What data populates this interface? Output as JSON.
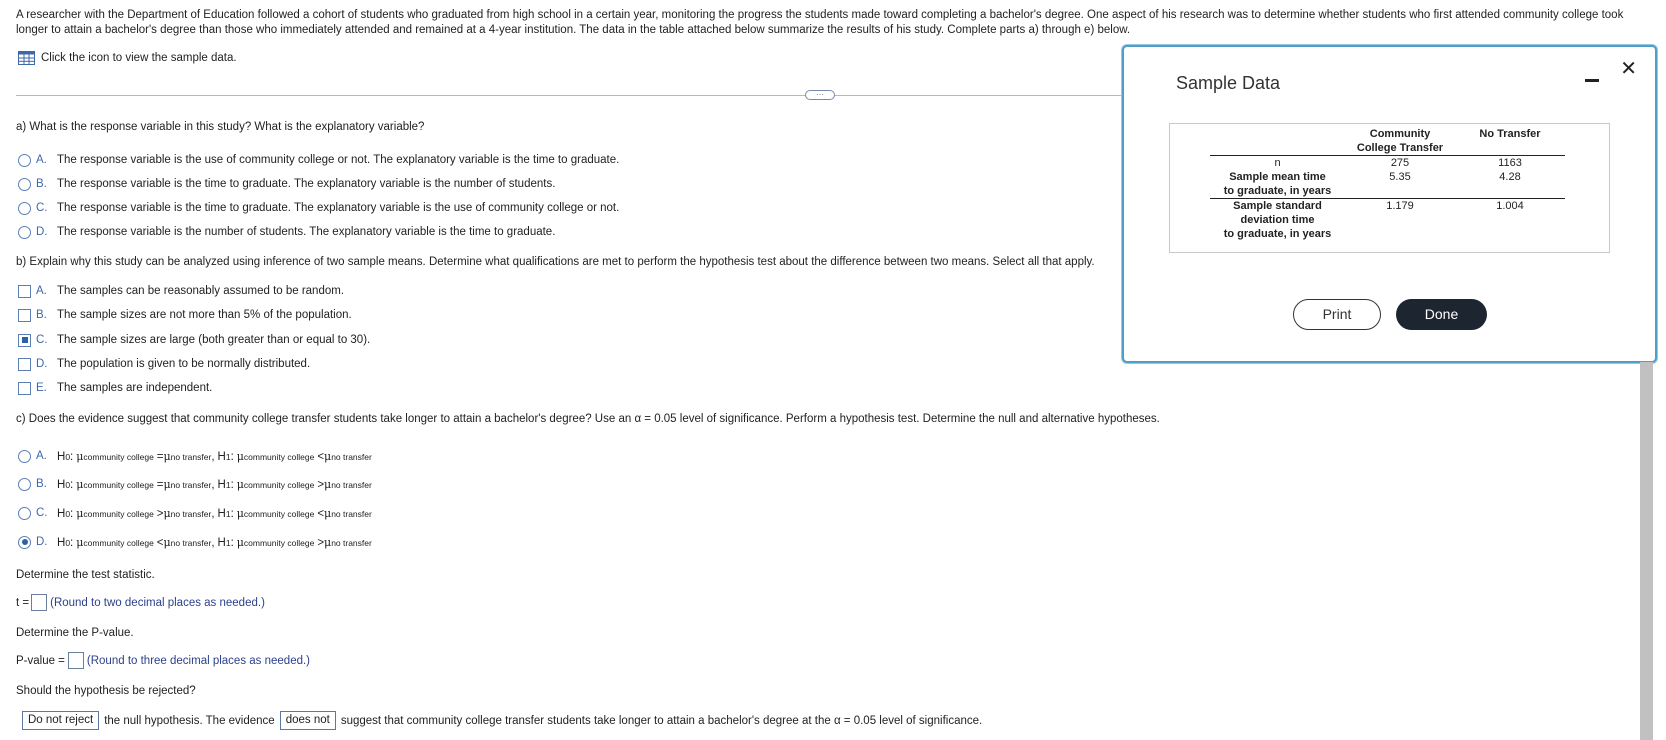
{
  "intro": "A researcher with the Department of Education followed a cohort of students who graduated from high school in a certain year, monitoring the progress the students made toward completing a bachelor's degree. One aspect of his research was to determine whether students who first attended community college took longer to attain a bachelor's degree than those who immediately attended and remained at a 4-year institution. The data in the table attached below summarize the results of his study. Complete parts a) through e) below.",
  "sample_link": "Click the icon to view the sample data.",
  "expand_label": "···",
  "part_a": {
    "question": "a) What is the response variable in this study? What is the explanatory variable?",
    "options": [
      {
        "letter": "A.",
        "text": "The response variable is the use of community college or not. The explanatory variable is the time to graduate."
      },
      {
        "letter": "B.",
        "text": "The response variable is the time to graduate. The explanatory variable is the number of students."
      },
      {
        "letter": "C.",
        "text": "The response variable is the time to graduate. The explanatory variable is the use of community college or not."
      },
      {
        "letter": "D.",
        "text": "The response variable is the number of students. The explanatory variable is the time to graduate."
      }
    ]
  },
  "part_b": {
    "question": "b) Explain why this study can be analyzed using inference of two sample means. Determine what qualifications are met to perform the hypothesis test about the difference between two means. Select all that apply.",
    "options": [
      {
        "letter": "A.",
        "text": "The samples can be reasonably assumed to be random."
      },
      {
        "letter": "B.",
        "text": "The sample sizes are not more than 5% of the population."
      },
      {
        "letter": "C.",
        "text": "The sample sizes are large (both greater than or equal to 30)."
      },
      {
        "letter": "D.",
        "text": "The population is given to be normally distributed."
      },
      {
        "letter": "E.",
        "text": "The samples are independent."
      }
    ]
  },
  "part_c": {
    "question": "c) Does the evidence suggest that community college transfer students take longer to attain a bachelor's degree? Use an α = 0.05 level of significance. Perform a hypothesis test. Determine the null and alternative hypotheses.",
    "h0": "H",
    "h0_sub": "0",
    "h1": "H",
    "h1_sub": "1",
    "mu": "μ",
    "sub_cc": "community college",
    "sub_nt": "no transfer",
    "options": [
      {
        "letter": "A.",
        "op0": "=",
        "op1": "<"
      },
      {
        "letter": "B.",
        "op0": "=",
        "op1": ">"
      },
      {
        "letter": "C.",
        "op0": ">",
        "op1": "<"
      },
      {
        "letter": "D.",
        "op0": "<",
        "op1": ">"
      }
    ],
    "test_stat_prompt": "Determine the test statistic.",
    "t_label": "t =",
    "t_hint": "(Round to two decimal places as needed.)",
    "pvalue_prompt": "Determine the P-value.",
    "p_label": "P-value =",
    "p_hint": "(Round to three decimal places as needed.)",
    "reject_prompt": "Should the hypothesis be rejected?",
    "conclusion": {
      "drop1": "Do not reject",
      "mid": "the null hypothesis. The evidence",
      "drop2": "does not",
      "end": "suggest that community college transfer students take longer to attain a bachelor's degree at the α = 0.05 level of significance."
    }
  },
  "modal": {
    "title": "Sample Data",
    "col1": [
      "Community",
      "College Transfer"
    ],
    "col2": "No Transfer",
    "rows": [
      {
        "label": [
          "n"
        ],
        "v1": "275",
        "v2": "1163"
      },
      {
        "label": [
          "Sample mean time",
          "to graduate, in years"
        ],
        "v1": "5.35",
        "v2": "4.28"
      },
      {
        "label": [
          "Sample standard",
          "deviation time",
          "to graduate, in years"
        ],
        "v1": "1.179",
        "v2": "1.004"
      }
    ],
    "print_label": "Print",
    "done_label": "Done",
    "close_label": "✕"
  },
  "colors": {
    "accent": "#4d9ec9",
    "radio": "#2f5fa5",
    "hint": "#2c3f8e",
    "done_bg": "#1d2530"
  }
}
